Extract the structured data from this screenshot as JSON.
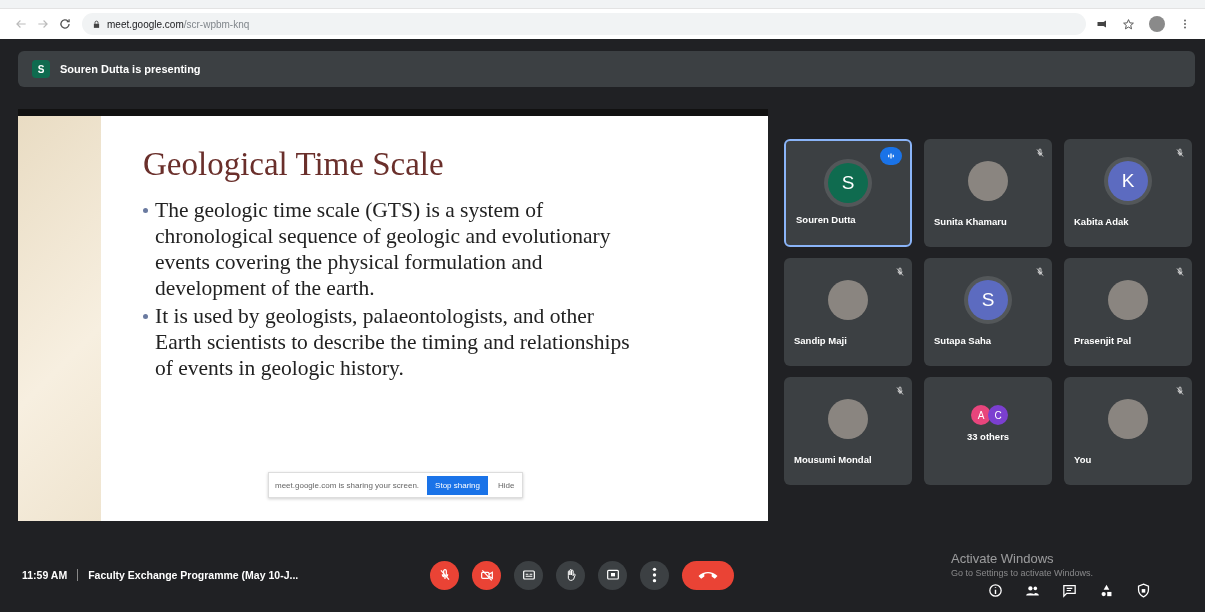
{
  "browser": {
    "url_host": "meet.google.com",
    "url_path": "/scr-wpbm-knq"
  },
  "presenting": {
    "avatar_letter": "S",
    "text": "Souren Dutta is presenting"
  },
  "slide": {
    "title": "Geological Time Scale",
    "bullets": [
      "The geologic time scale (GTS) is a system of chronological sequence of geologic and evolutionary events covering the physical formulation and development of the earth.",
      "It is used by geologists, palaeontologists, and other Earth scientists to describe the timing and relationships of events in geologic history."
    ],
    "share_bar": {
      "message": "meet.google.com is sharing your screen.",
      "stop_button": "Stop sharing",
      "hide_button": "Hide"
    }
  },
  "tiles": [
    {
      "name": "Souren Dutta",
      "avatar": {
        "kind": "letter",
        "letter": "S",
        "color": "#0f6b4f"
      },
      "muted": false,
      "speaking": true,
      "selected": true
    },
    {
      "name": "Sunita Khamaru",
      "avatar": {
        "kind": "photo"
      },
      "muted": true,
      "speaking": false,
      "selected": false
    },
    {
      "name": "Kabita Adak",
      "avatar": {
        "kind": "letter",
        "letter": "K",
        "color": "#5c6bc0"
      },
      "muted": true,
      "speaking": false,
      "selected": false
    },
    {
      "name": "Sandip Maji",
      "avatar": {
        "kind": "photo"
      },
      "muted": true,
      "speaking": false,
      "selected": false
    },
    {
      "name": "Sutapa Saha",
      "avatar": {
        "kind": "letter",
        "letter": "S",
        "color": "#5c6bc0"
      },
      "muted": true,
      "speaking": false,
      "selected": false
    },
    {
      "name": "Prasenjit Pal",
      "avatar": {
        "kind": "photo"
      },
      "muted": true,
      "speaking": false,
      "selected": false
    },
    {
      "name": "Mousumi Mondal",
      "avatar": {
        "kind": "photo"
      },
      "muted": true,
      "speaking": false,
      "selected": false
    },
    {
      "name": "33 others",
      "avatar": {
        "kind": "group",
        "chips": [
          {
            "letter": "A",
            "color": "#e8457c"
          },
          {
            "letter": "C",
            "color": "#7b3fd0"
          }
        ]
      },
      "muted": false,
      "speaking": false,
      "selected": false
    },
    {
      "name": "You",
      "avatar": {
        "kind": "photo"
      },
      "muted": true,
      "speaking": false,
      "selected": false
    }
  ],
  "bottom_bar": {
    "time": "11:59 AM",
    "meeting_title": "Faculty Exchange Programme (May 10-J...",
    "controls": [
      {
        "kind": "mic",
        "off": true
      },
      {
        "kind": "camera",
        "off": true
      },
      {
        "kind": "captions",
        "off": false
      },
      {
        "kind": "hand",
        "off": false
      },
      {
        "kind": "present",
        "off": false
      },
      {
        "kind": "more",
        "off": false
      },
      {
        "kind": "hangup",
        "off": false
      }
    ],
    "side_icons": [
      {
        "kind": "info"
      },
      {
        "kind": "people"
      },
      {
        "kind": "chat"
      },
      {
        "kind": "activities"
      },
      {
        "kind": "lock"
      }
    ]
  },
  "os_notice": {
    "title": "Activate Windows",
    "subtitle": "Go to Settings to activate Windows."
  }
}
